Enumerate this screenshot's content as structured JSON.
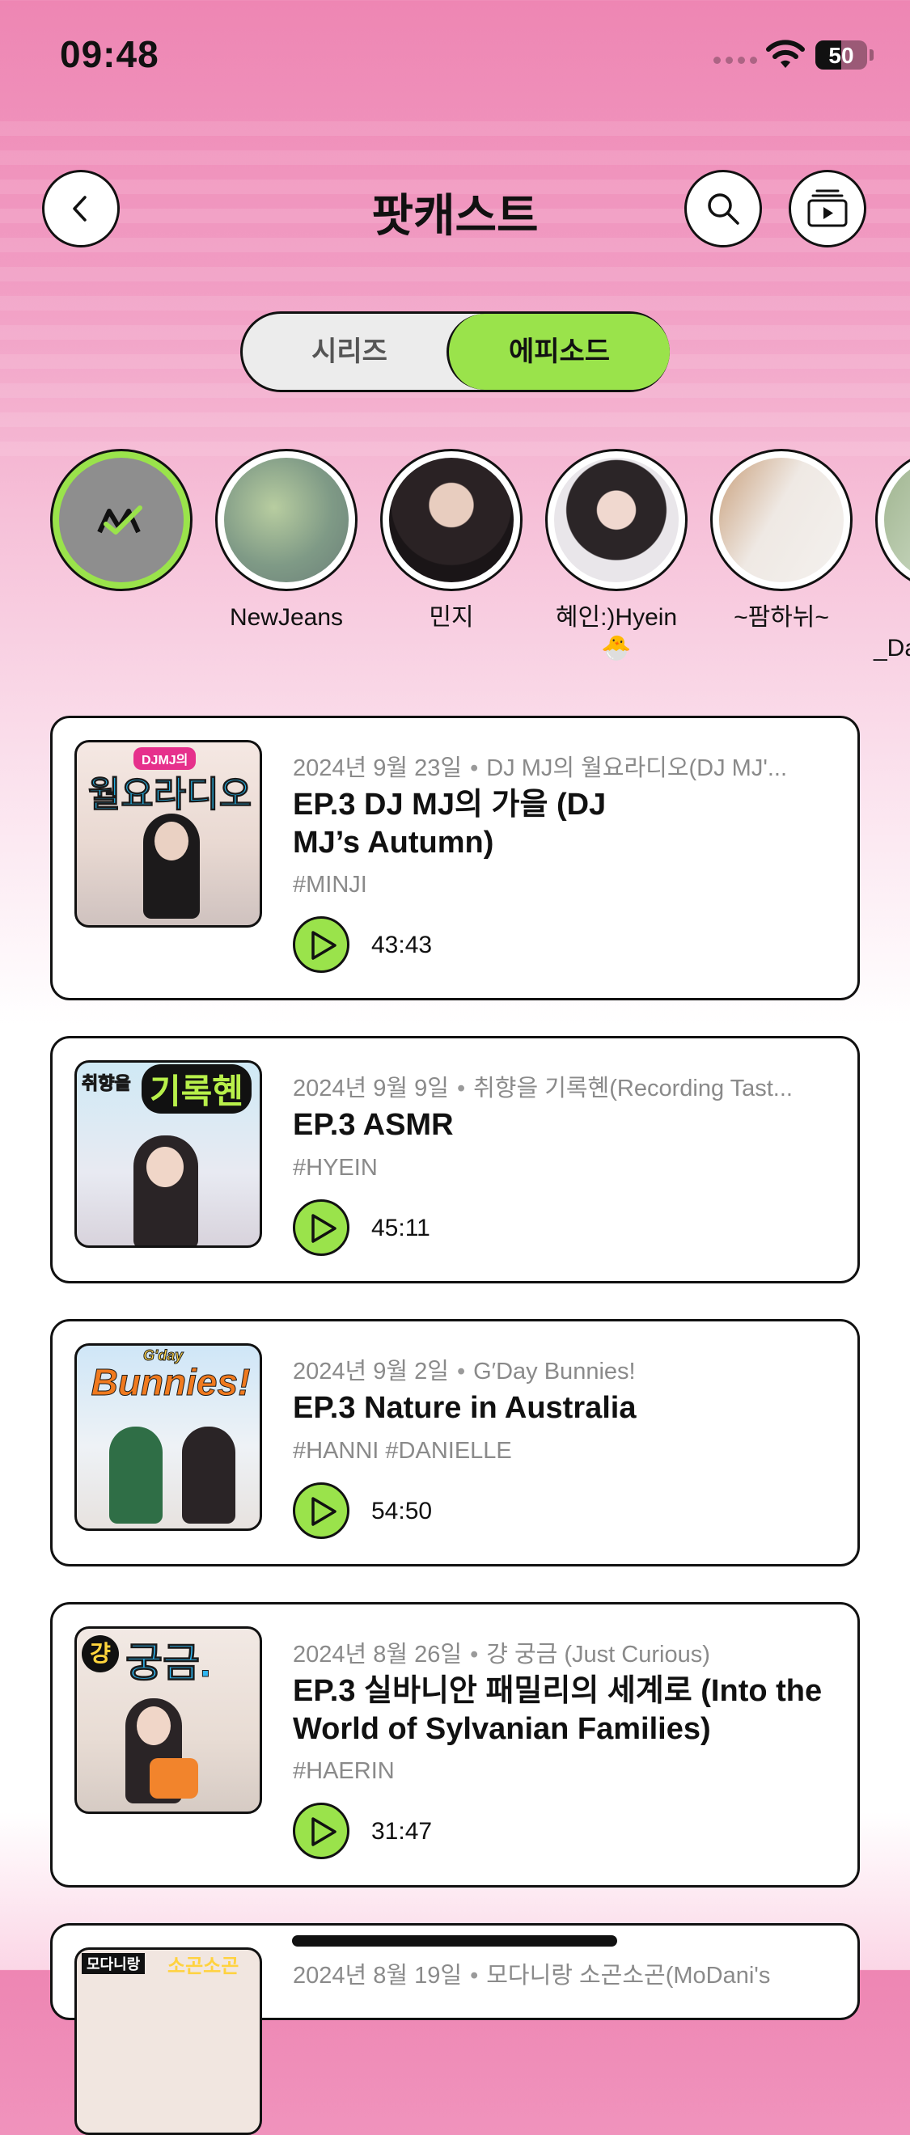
{
  "status_bar": {
    "time": "09:48",
    "battery": "50",
    "battery_level": 0.5
  },
  "header": {
    "title": "팟캐스트"
  },
  "segments": {
    "left": "시리즈",
    "right": "에피소드",
    "selected": "에피소드"
  },
  "stories": [
    {
      "label": "",
      "active": true
    },
    {
      "label": "NewJeans"
    },
    {
      "label": "민지"
    },
    {
      "label": "혜인:)Hyein"
    },
    {
      "label": "~팜하뉘~"
    },
    {
      "label": "_Da"
    }
  ],
  "episodes": [
    {
      "date": "2024년 9월 23일",
      "series": "DJ MJ의 월요라디오(DJ MJ'...",
      "title": "EP.3 DJ MJ의 가을 (DJ MJ’s Autumn)",
      "tags": "#MINJI",
      "duration": "43:43",
      "thumb_text": "월요라디오",
      "thumb_badge": "DJMJ의"
    },
    {
      "date": "2024년 9월 9일",
      "series": "취향을 기록혠(Recording Tast...",
      "title": "EP.3 ASMR",
      "tags": "#HYEIN",
      "duration": "45:11",
      "thumb_text": "기록혠",
      "thumb_badge": "취향을"
    },
    {
      "date": "2024년 9월 2일",
      "series": "G′Day Bunnies!",
      "title": "EP.3 Nature in Australia",
      "tags": "#HANNI #DANIELLE",
      "duration": "54:50",
      "thumb_text": "Bunnies!",
      "thumb_badge": "G'day"
    },
    {
      "date": "2024년 8월 26일",
      "series": "걍 궁금 (Just Curious)",
      "title": "EP.3 실바니안 패밀리의 세계로 (Into the World of Sylvanian Families)",
      "tags": "#HAERIN",
      "duration": "31:47",
      "thumb_text": "궁금.",
      "thumb_badge": "걍"
    },
    {
      "date": "2024년 8월 19일",
      "series": "모다니랑 소곤소곤(MoDani's",
      "thumb_text": "소곤소곤",
      "thumb_badge": "모다니랑"
    }
  ]
}
